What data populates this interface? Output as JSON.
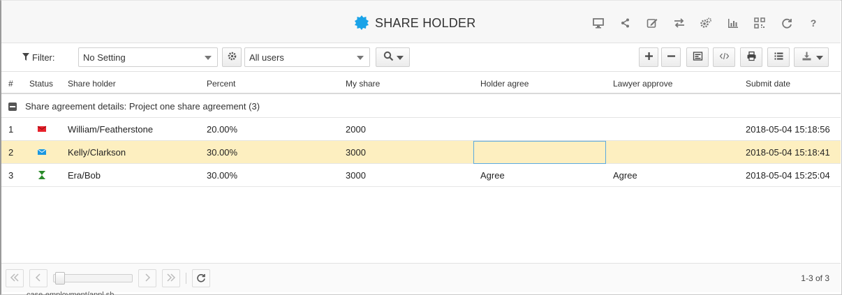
{
  "header": {
    "title": "SHARE HOLDER",
    "logo_icon": "gear-badge-icon",
    "accent_color": "#1aa3e8",
    "icons": [
      "monitor-icon",
      "share-icon",
      "edit-icon",
      "swap-icon",
      "settings-icon",
      "bar-chart-icon",
      "qr-code-icon",
      "refresh-icon",
      "help-icon"
    ]
  },
  "toolbar": {
    "filter_label": "Filter:",
    "setting_select": "No Setting",
    "users_select": "All users"
  },
  "table": {
    "columns": [
      "#",
      "Status",
      "Share holder",
      "Percent",
      "My share",
      "Holder agree",
      "Lawyer approve",
      "Submit date"
    ],
    "group_label": "Share agreement details: Project one share agreement (3)",
    "rows": [
      {
        "num": "1",
        "status_icon": "envelope-closed-icon",
        "holder": "William/Featherstone",
        "percent": "20.00%",
        "share": "2000",
        "holder_agree": "",
        "lawyer_approve": "",
        "date": "2018-05-04 15:18:56"
      },
      {
        "num": "2",
        "status_icon": "envelope-blue-icon",
        "holder": "Kelly/Clarkson",
        "percent": "30.00%",
        "share": "3000",
        "holder_agree": "",
        "lawyer_approve": "",
        "date": "2018-05-04 15:18:41"
      },
      {
        "num": "3",
        "status_icon": "hourglass-icon",
        "holder": "Era/Bob",
        "percent": "30.00%",
        "share": "3000",
        "holder_agree": "Agree",
        "lawyer_approve": "Agree",
        "date": "2018-05-04 15:25:04"
      }
    ]
  },
  "footer": {
    "pager_info": "1-3 of 3"
  },
  "below_text": "case-employment/appl.sb"
}
